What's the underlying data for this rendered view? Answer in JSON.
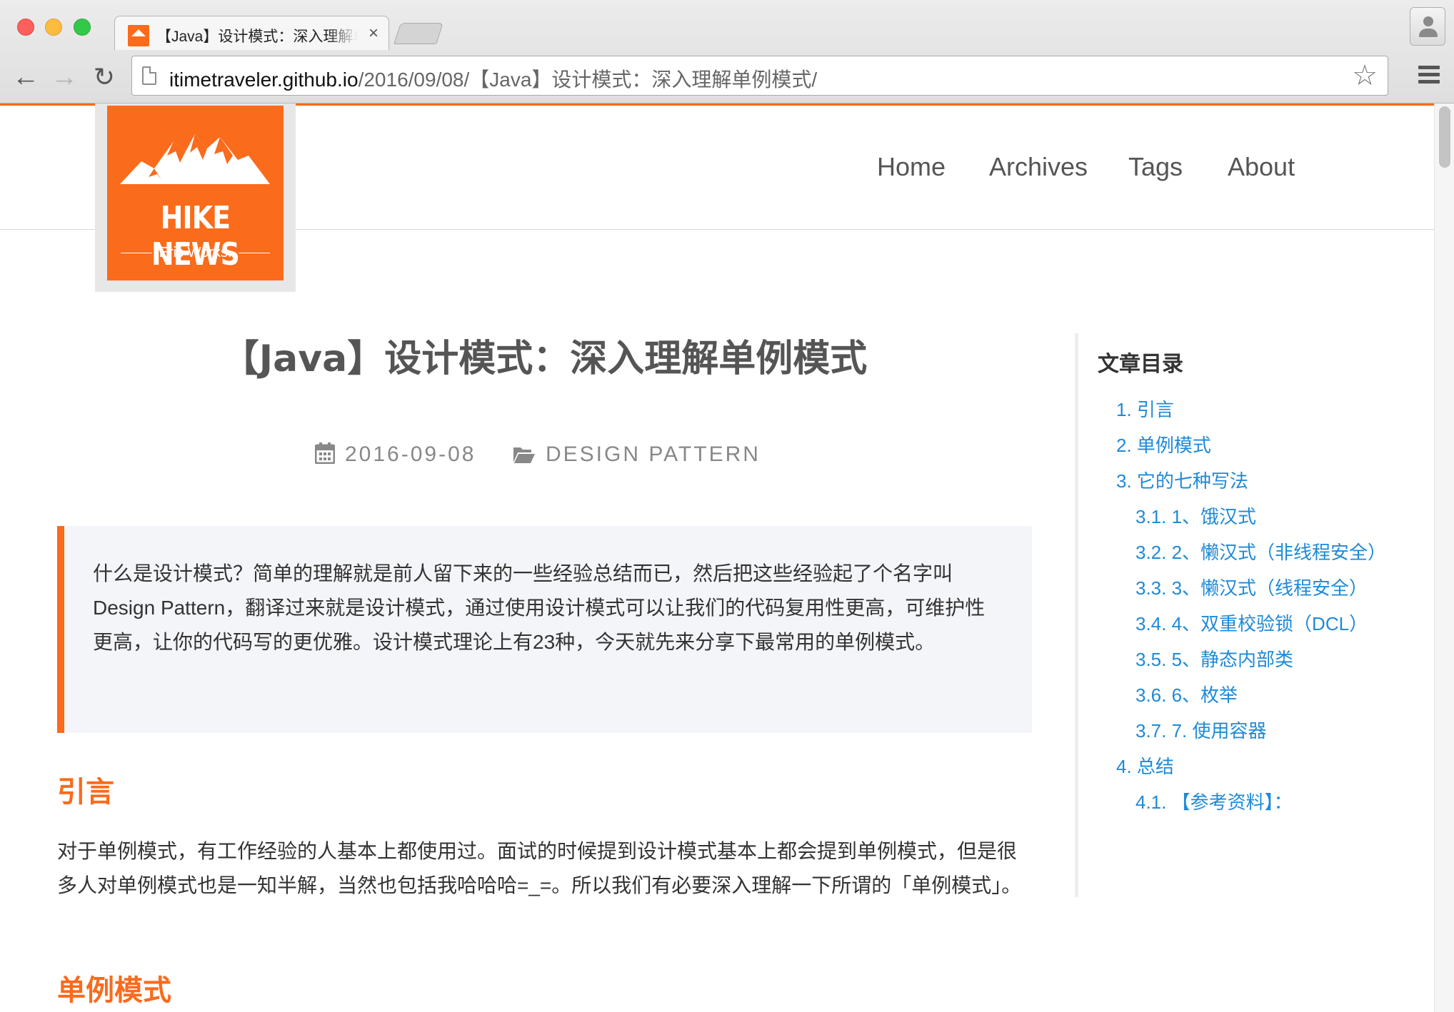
{
  "browser": {
    "tab_title": "【Java】设计模式：深入理解单例模式",
    "tab_close": "×",
    "url_host": "itimetraveler.github.io",
    "url_path": "/2016/09/08/【Java】设计模式：深入理解单例模式/"
  },
  "site": {
    "logo_title": "HIKE NEWS",
    "logo_subtitle": "Eric Works.",
    "accent_color": "#fa6b1b",
    "nav": [
      "Home",
      "Archives",
      "Tags",
      "About"
    ]
  },
  "post": {
    "title": "【Java】设计模式：深入理解单例模式",
    "date": "2016-09-08",
    "category": "DESIGN PATTERN",
    "date_icon": "calendar-icon",
    "category_icon": "folder-open-icon",
    "quote": "什么是设计模式？简单的理解就是前人留下来的一些经验总结而已，然后把这些经验起了个名字叫Design Pattern，翻译过来就是设计模式，通过使用设计模式可以让我们的代码复用性更高，可维护性更高，让你的代码写的更优雅。设计模式理论上有23种，今天就先来分享下最常用的单例模式。",
    "section1_heading": "引言",
    "section1_text": "对于单例模式，有工作经验的人基本上都使用过。面试的时候提到设计模式基本上都会提到单例模式，但是很多人对单例模式也是一知半解，当然也包括我哈哈哈=_=。所以我们有必要深入理解一下所谓的「单例模式」。",
    "section2_heading": "单例模式"
  },
  "toc": {
    "title": "文章目录",
    "items": [
      "1. 引言",
      "2. 单例模式",
      "3. 它的七种写法",
      "3.1. 1、饿汉式",
      "3.2. 2、懒汉式（非线程安全）",
      "3.3. 3、懒汉式（线程安全）",
      "3.4. 4、双重校验锁（DCL）",
      "3.5. 5、静态内部类",
      "3.6. 6、枚举",
      "3.7. 7. 使用容器",
      "4. 总结",
      "4.1. 【参考资料】："
    ]
  }
}
